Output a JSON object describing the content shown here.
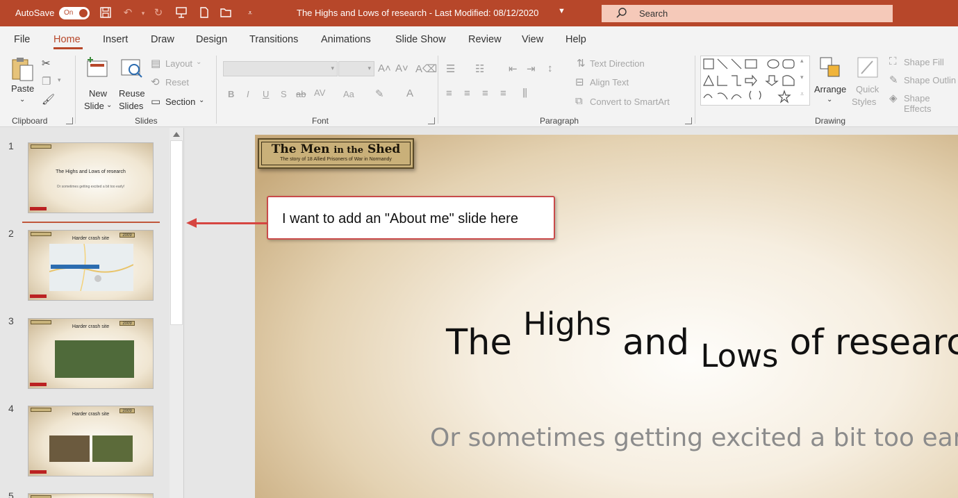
{
  "titlebar": {
    "autosave_label": "AutoSave",
    "autosave_state": "On",
    "document_title": "The Highs and Lows of research  -  Last Modified: 08/12/2020",
    "search_placeholder": "Search",
    "icons": [
      "save-icon",
      "undo-icon",
      "redo-icon",
      "presenter-icon",
      "new-file-icon",
      "open-folder-icon",
      "customize-qat-icon"
    ]
  },
  "menu": {
    "tabs": [
      "File",
      "Home",
      "Insert",
      "Draw",
      "Design",
      "Transitions",
      "Animations",
      "Slide Show",
      "Review",
      "View",
      "Help"
    ],
    "active": "Home"
  },
  "ribbon": {
    "clipboard": {
      "label": "Clipboard",
      "paste": "Paste"
    },
    "slides": {
      "label": "Slides",
      "new_slide_1": "New",
      "new_slide_2": "Slide",
      "reuse_1": "Reuse",
      "reuse_2": "Slides",
      "layout": "Layout",
      "reset": "Reset",
      "section": "Section"
    },
    "font": {
      "label": "Font",
      "bold": "B",
      "italic": "I",
      "underline": "U",
      "strike": "S",
      "spacing": "AV",
      "case": "Aa"
    },
    "paragraph": {
      "label": "Paragraph",
      "text_direction": "Text Direction",
      "align_text": "Align Text",
      "convert_smartart": "Convert to SmartArt"
    },
    "drawing": {
      "label": "Drawing",
      "arrange": "Arrange",
      "quick_styles_1": "Quick",
      "quick_styles_2": "Styles",
      "shape_fill": "Shape Fill",
      "shape_outline": "Shape Outlin",
      "shape_effects": "Shape Effects"
    }
  },
  "thumbnails": [
    {
      "number": "1",
      "title": "The Highs and Lows of research",
      "subtitle": "Or sometimes getting excited a bit too early!"
    },
    {
      "number": "2",
      "title": "Harder crash site",
      "year": "2009"
    },
    {
      "number": "3",
      "title": "Harder crash site",
      "year": "2009"
    },
    {
      "number": "4",
      "title": "Harder crash site",
      "year": "2009"
    },
    {
      "number": "5"
    }
  ],
  "slide": {
    "plaque_title_a": "The Men ",
    "plaque_title_b": "in the",
    "plaque_title_c": " Shed",
    "plaque_subtitle": "The story of 18 Allied Prisoners of War in Normandy",
    "title_the": "The ",
    "title_highs": "Highs",
    "title_and": " and ",
    "title_lows": "Lows",
    "title_of": " of research",
    "subtitle": "Or sometimes getting excited a bit too early!"
  },
  "callout": {
    "text": "I want to add an \"About me\" slide here"
  },
  "colors": {
    "accent": "#b7472a",
    "arrow": "#d64541",
    "ribbon_bg": "#f3f3f3"
  }
}
